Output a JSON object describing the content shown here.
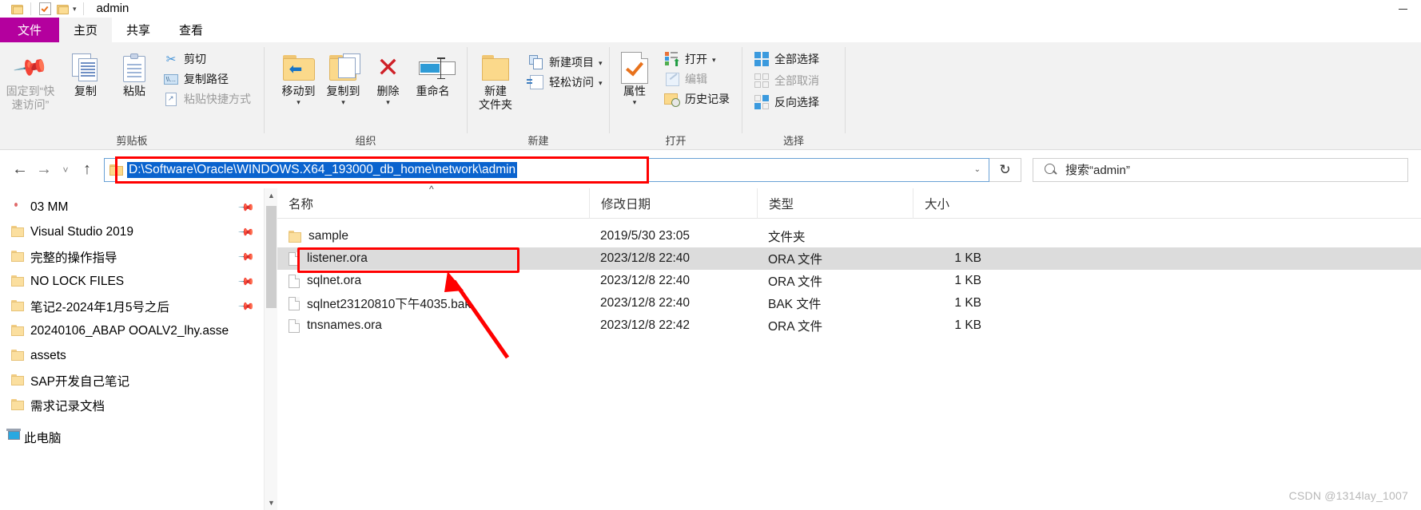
{
  "window": {
    "title": "admin",
    "minimize_label": "—",
    "quick_access": [
      "folder-icon",
      "check-document-icon",
      "folder-icon",
      "dropdown-caret"
    ]
  },
  "tabs": [
    {
      "id": "file",
      "label": "文件"
    },
    {
      "id": "home",
      "label": "主页"
    },
    {
      "id": "share",
      "label": "共享"
    },
    {
      "id": "view",
      "label": "查看"
    }
  ],
  "ribbon": {
    "groups": [
      {
        "name": "clipboard",
        "label": "剪贴板",
        "big": [
          {
            "label": "固定到“快\n速访问”",
            "icon": "pin-icon",
            "dim": true
          },
          {
            "label": "复制",
            "icon": "copy-icon"
          },
          {
            "label": "粘贴",
            "icon": "paste-icon"
          }
        ],
        "small": [
          {
            "label": "剪切",
            "icon": "scissors-icon"
          },
          {
            "label": "复制路径",
            "icon": "copy-path-icon"
          },
          {
            "label": "粘贴快捷方式",
            "icon": "paste-shortcut-icon",
            "dim": true
          }
        ]
      },
      {
        "name": "organize",
        "label": "组织",
        "big": [
          {
            "label": "移动到",
            "icon": "move-to-icon",
            "caret": true
          },
          {
            "label": "复制到",
            "icon": "copy-to-icon",
            "caret": true
          },
          {
            "label": "删除",
            "icon": "delete-icon",
            "caret": true
          },
          {
            "label": "重命名",
            "icon": "rename-icon"
          }
        ],
        "small": []
      },
      {
        "name": "new",
        "label": "新建",
        "big": [
          {
            "label": "新建\n文件夹",
            "icon": "new-folder-icon"
          }
        ],
        "small": [
          {
            "label": "新建项目",
            "icon": "new-item-icon",
            "caret": true
          },
          {
            "label": "轻松访问",
            "icon": "easy-access-icon",
            "caret": true
          }
        ]
      },
      {
        "name": "open",
        "label": "打开",
        "big": [
          {
            "label": "属性",
            "icon": "properties-icon",
            "caret": true
          }
        ],
        "small": [
          {
            "label": "打开",
            "icon": "open-icon",
            "caret": true
          },
          {
            "label": "编辑",
            "icon": "edit-icon",
            "dim": true
          },
          {
            "label": "历史记录",
            "icon": "history-icon"
          }
        ]
      },
      {
        "name": "select",
        "label": "选择",
        "big": [],
        "small": [
          {
            "label": "全部选择",
            "icon": "select-all-icon"
          },
          {
            "label": "全部取消",
            "icon": "select-none-icon",
            "dim": true
          },
          {
            "label": "反向选择",
            "icon": "invert-selection-icon"
          }
        ]
      }
    ]
  },
  "navbar": {
    "back_icon": "back-arrow-icon",
    "forward_icon": "forward-arrow-icon",
    "recent_icon": "recent-locations-caret-icon",
    "up_icon": "up-arrow-icon",
    "address_value": "D:\\Software\\Oracle\\WINDOWS.X64_193000_db_home\\network\\admin",
    "address_dropdown_icon": "chevron-down-icon",
    "refresh_icon": "refresh-icon",
    "search_placeholder": "搜索“admin”",
    "search_icon": "search-icon"
  },
  "sidebar": {
    "items": [
      {
        "label": "03 MM",
        "icon": "red-ball-icon",
        "pinned": true
      },
      {
        "label": "Visual Studio 2019",
        "icon": "folder-icon",
        "pinned": true
      },
      {
        "label": "完整的操作指导",
        "icon": "folder-icon",
        "pinned": true
      },
      {
        "label": "NO LOCK FILES",
        "icon": "folder-icon",
        "pinned": true
      },
      {
        "label": "笔记2-2024年1月5号之后",
        "icon": "folder-icon",
        "pinned": true
      },
      {
        "label": "20240106_ABAP OOALV2_lhy.asse",
        "icon": "folder-icon",
        "pinned": false
      },
      {
        "label": "assets",
        "icon": "folder-icon",
        "pinned": false
      },
      {
        "label": "SAP开发自己笔记",
        "icon": "folder-icon",
        "pinned": false
      },
      {
        "label": "需求记录文档",
        "icon": "folder-icon",
        "pinned": false
      },
      {
        "label": "此电脑",
        "icon": "this-pc-icon",
        "pinned": false
      }
    ]
  },
  "filelist": {
    "columns": [
      "名称",
      "修改日期",
      "类型",
      "大小"
    ],
    "sort_indicator": "^",
    "rows": [
      {
        "name": "sample",
        "icon": "folder-icon",
        "date": "2019/5/30 23:05",
        "type": "文件夹",
        "size": "",
        "selected": false
      },
      {
        "name": "listener.ora",
        "icon": "file-icon",
        "date": "2023/12/8 22:40",
        "type": "ORA 文件",
        "size": "1 KB",
        "selected": true
      },
      {
        "name": "sqlnet.ora",
        "icon": "file-icon",
        "date": "2023/12/8 22:40",
        "type": "ORA 文件",
        "size": "1 KB",
        "selected": false
      },
      {
        "name": "sqlnet23120810下午4035.bak",
        "icon": "file-icon",
        "date": "2023/12/8 22:40",
        "type": "BAK 文件",
        "size": "1 KB",
        "selected": false
      },
      {
        "name": "tnsnames.ora",
        "icon": "file-icon",
        "date": "2023/12/8 22:42",
        "type": "ORA 文件",
        "size": "1 KB",
        "selected": false
      }
    ]
  },
  "annotations": {
    "highlight_color": "#ff0000",
    "address_box_highlight": true,
    "listener_row_highlight": true,
    "pointer_arrow": true
  },
  "watermark": "CSDN @1314lay_1007"
}
